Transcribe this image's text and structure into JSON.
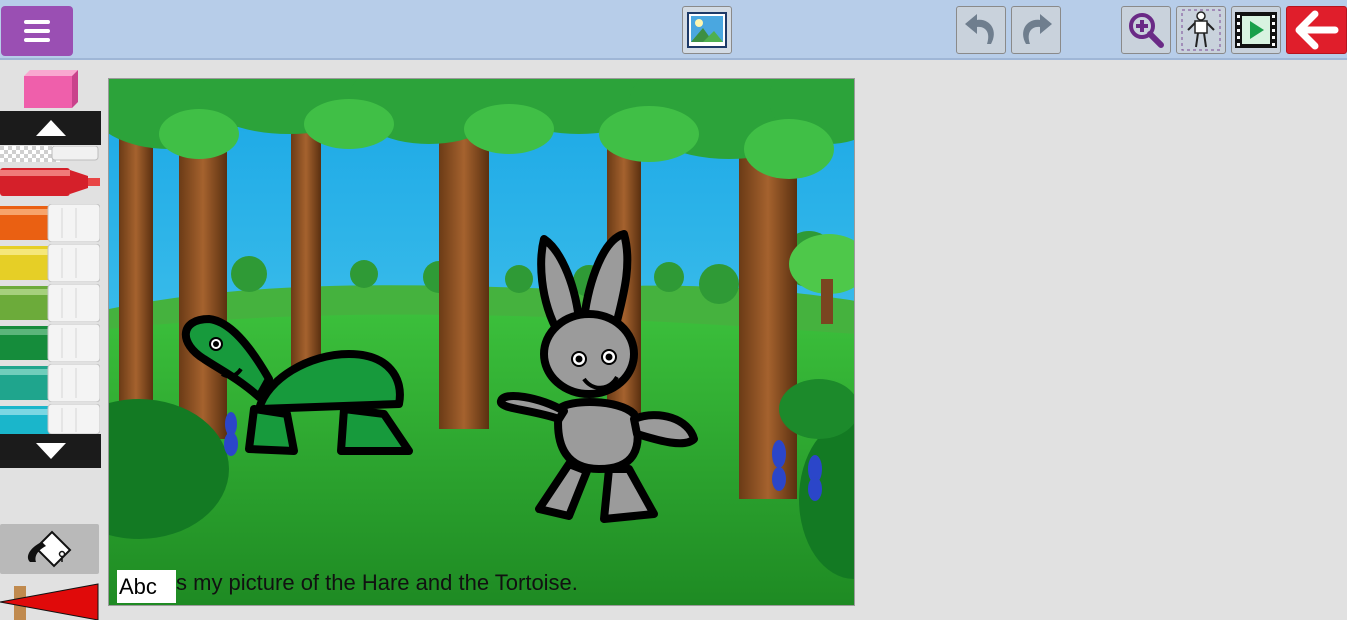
{
  "toolbar": {
    "menu_icon": "hamburger-menu-icon",
    "image_icon": "picture-icon",
    "undo_icon": "undo-icon",
    "redo_icon": "redo-icon",
    "zoom_icon": "zoom-in-icon",
    "character_icon": "character-pose-icon",
    "play_icon": "play-movie-icon",
    "back_icon": "back-arrow-icon",
    "colors": {
      "bar": "#b7cde9",
      "menu": "#9a4fb3",
      "back": "#e01e2b",
      "zoom": "#6a2a86"
    }
  },
  "palette": {
    "eraser_icon": "eraser-icon",
    "scroll_up_icon": "arrow-up-icon",
    "scroll_down_icon": "arrow-down-icon",
    "fill_icon": "paint-bucket-icon",
    "brush_icon": "brush-size-icon",
    "markers": [
      {
        "name": "transparent",
        "color": "#d8d8d8"
      },
      {
        "name": "red",
        "color": "#d5202a"
      },
      {
        "name": "orange",
        "color": "#ea6012"
      },
      {
        "name": "yellow",
        "color": "#e6cf26"
      },
      {
        "name": "light-green",
        "color": "#6cab3a"
      },
      {
        "name": "green",
        "color": "#158c3b"
      },
      {
        "name": "teal",
        "color": "#1fa58d"
      },
      {
        "name": "cyan",
        "color": "#1ab6cb"
      }
    ]
  },
  "canvas": {
    "caption_text": "s my picture of the Hare and the Tortoise.",
    "text_tool_label": "Abc"
  }
}
